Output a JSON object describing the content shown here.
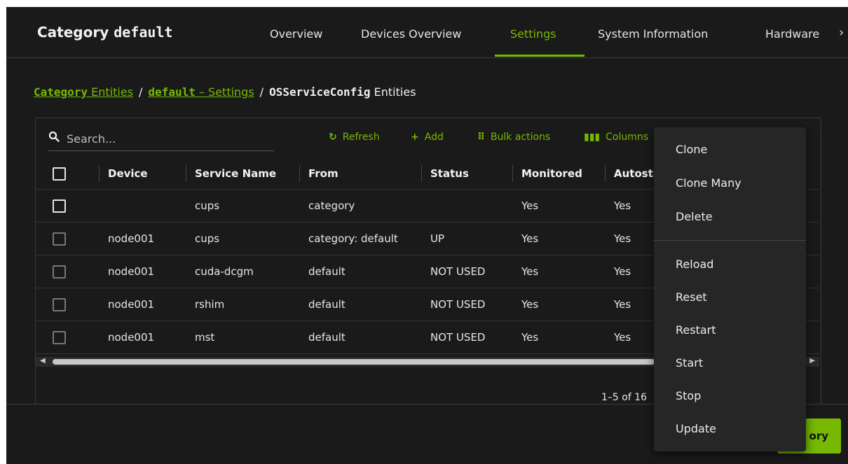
{
  "header": {
    "title_prefix": "Category",
    "title_name": "default",
    "tabs": [
      {
        "label": "Overview"
      },
      {
        "label": "Devices Overview"
      },
      {
        "label": "Settings"
      },
      {
        "label": "System Information"
      },
      {
        "label": "Hardware"
      }
    ],
    "more": "›"
  },
  "breadcrumb": {
    "cat_mono": "Category",
    "cat_text": "Entities",
    "def_mono": "default",
    "def_text": "– Settings",
    "sep": "/",
    "leaf_mono": "OSServiceConfig",
    "leaf_text": "Entities"
  },
  "toolbar": {
    "search_placeholder": "Search...",
    "refresh": "Refresh",
    "add": "Add",
    "bulk": "Bulk actions",
    "columns": "Columns"
  },
  "table": {
    "headers": [
      "Device",
      "Service Name",
      "From",
      "Status",
      "Monitored",
      "Autostart"
    ],
    "rows": [
      {
        "device": "",
        "service": "cups",
        "from": "category",
        "status": "",
        "monitored": "Yes",
        "autostart": "Yes"
      },
      {
        "device": "node001",
        "service": "cups",
        "from": "category: default",
        "status": "UP",
        "monitored": "Yes",
        "autostart": "Yes"
      },
      {
        "device": "node001",
        "service": "cuda-dcgm",
        "from": "default",
        "status": "NOT USED",
        "monitored": "Yes",
        "autostart": "Yes"
      },
      {
        "device": "node001",
        "service": "rshim",
        "from": "default",
        "status": "NOT USED",
        "monitored": "Yes",
        "autostart": "Yes"
      },
      {
        "device": "node001",
        "service": "mst",
        "from": "default",
        "status": "NOT USED",
        "monitored": "Yes",
        "autostart": "Yes"
      }
    ]
  },
  "pagination": "1–5 of 16",
  "footer": {
    "save_label": "ory"
  },
  "menu": {
    "items": [
      "Clone",
      "Clone Many",
      "Delete",
      "Reload",
      "Reset",
      "Restart",
      "Start",
      "Stop",
      "Update"
    ]
  },
  "colors": {
    "accent": "#76b900",
    "background": "#1a1a1a",
    "menu_bg": "#262626"
  }
}
